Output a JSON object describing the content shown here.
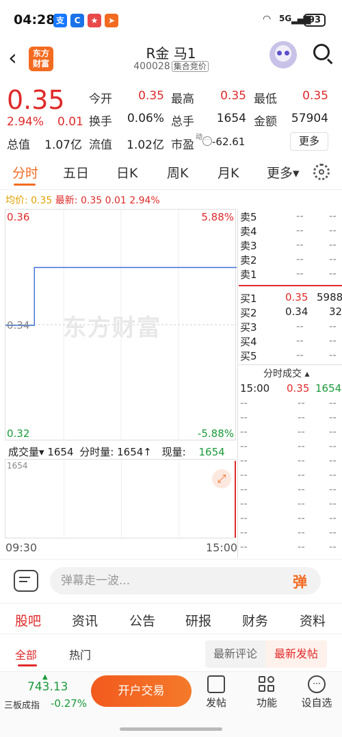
{
  "status": {
    "time": "04:28",
    "apps": [
      {
        "name": "alipay-icon",
        "glyph": "支",
        "color": "#1677ff"
      },
      {
        "name": "app-icon-2",
        "glyph": "C",
        "color": "#1a73e8"
      },
      {
        "name": "app-icon-3",
        "glyph": "★",
        "color": "#e84a4a"
      },
      {
        "name": "app-icon-4",
        "glyph": "➤",
        "color": "#f36b21"
      }
    ],
    "network": "5G",
    "battery": "93"
  },
  "header": {
    "logo_line1": "东方",
    "logo_line2": "财富",
    "title": "R金  马1",
    "code": "400028",
    "badge": "集合竞价"
  },
  "quote": {
    "price": "0.35",
    "change_pct": "2.94%",
    "change": "0.01",
    "open_label": "今开",
    "open": "0.35",
    "high_label": "最高",
    "high": "0.35",
    "low_label": "最低",
    "low": "0.35",
    "turnover_label": "换手",
    "turnover": "0.06%",
    "volume_label": "总手",
    "volume": "1654",
    "amount_label": "金额",
    "amount": "57904",
    "mktcap_label": "总值",
    "mktcap": "1.07亿",
    "float_label": "流值",
    "float": "1.02亿",
    "pe_label": "市盈",
    "pe_sup": "动",
    "pe": "-62.61",
    "more": "更多"
  },
  "tabs": [
    "分时",
    "五日",
    "日K",
    "周K",
    "月K",
    "更多▾"
  ],
  "avgline": {
    "avg_label": "均价:",
    "avg": "0.35",
    "latest_label": "最新:",
    "latest": "0.35",
    "latest_change": "0.01",
    "latest_pct": "2.94%"
  },
  "chart": {
    "top_price": "0.36",
    "top_pct": "5.88%",
    "mid_price": "0.34",
    "bottom_price": "0.32",
    "bottom_pct": "-5.88%",
    "watermark": "东方财富",
    "vol_label": "成交量▾",
    "vol_total": "1654",
    "interval_label": "分时量:",
    "interval_val": "1654↑",
    "cur_label": "现量:",
    "cur_val": "1654",
    "vol_axis": "1654",
    "time_start": "09:30",
    "time_end": "15:00"
  },
  "chart_data": {
    "type": "line",
    "x": [
      "09:30",
      "10:00",
      "15:00"
    ],
    "ylim": [
      0.32,
      0.36
    ],
    "series": [
      {
        "values": [
          0.34,
          0.35,
          0.35
        ]
      }
    ]
  },
  "orderbook": {
    "asks": [
      {
        "label": "卖5",
        "price": "--",
        "vol": "--"
      },
      {
        "label": "卖4",
        "price": "--",
        "vol": "--"
      },
      {
        "label": "卖3",
        "price": "--",
        "vol": "--"
      },
      {
        "label": "卖2",
        "price": "--",
        "vol": "--"
      },
      {
        "label": "卖1",
        "price": "--",
        "vol": "--"
      }
    ],
    "bids": [
      {
        "label": "买1",
        "price": "0.35",
        "vol": "5988"
      },
      {
        "label": "买2",
        "price": "0.34",
        "vol": "32"
      },
      {
        "label": "买3",
        "price": "--",
        "vol": "--"
      },
      {
        "label": "买4",
        "price": "--",
        "vol": "--"
      },
      {
        "label": "买5",
        "price": "--",
        "vol": "--"
      }
    ]
  },
  "trades": {
    "title": "分时成交 ▴",
    "first": {
      "time": "15:00",
      "price": "0.35",
      "vol": "1654"
    },
    "empty": "--"
  },
  "danmaku": {
    "placeholder": "弹幕走一波...",
    "button": "弹"
  },
  "bottom_tabs": [
    "股吧",
    "资讯",
    "公告",
    "研报",
    "财务",
    "资料"
  ],
  "sub_tabs": [
    "全部",
    "热门"
  ],
  "segments": [
    "最新评论",
    "最新发帖"
  ],
  "nav": {
    "index_value": "743.13",
    "index_name": "三板成指",
    "index_change": "-0.27%",
    "trade_button": "开户交易",
    "items": [
      "发帖",
      "功能",
      "设自选"
    ]
  }
}
